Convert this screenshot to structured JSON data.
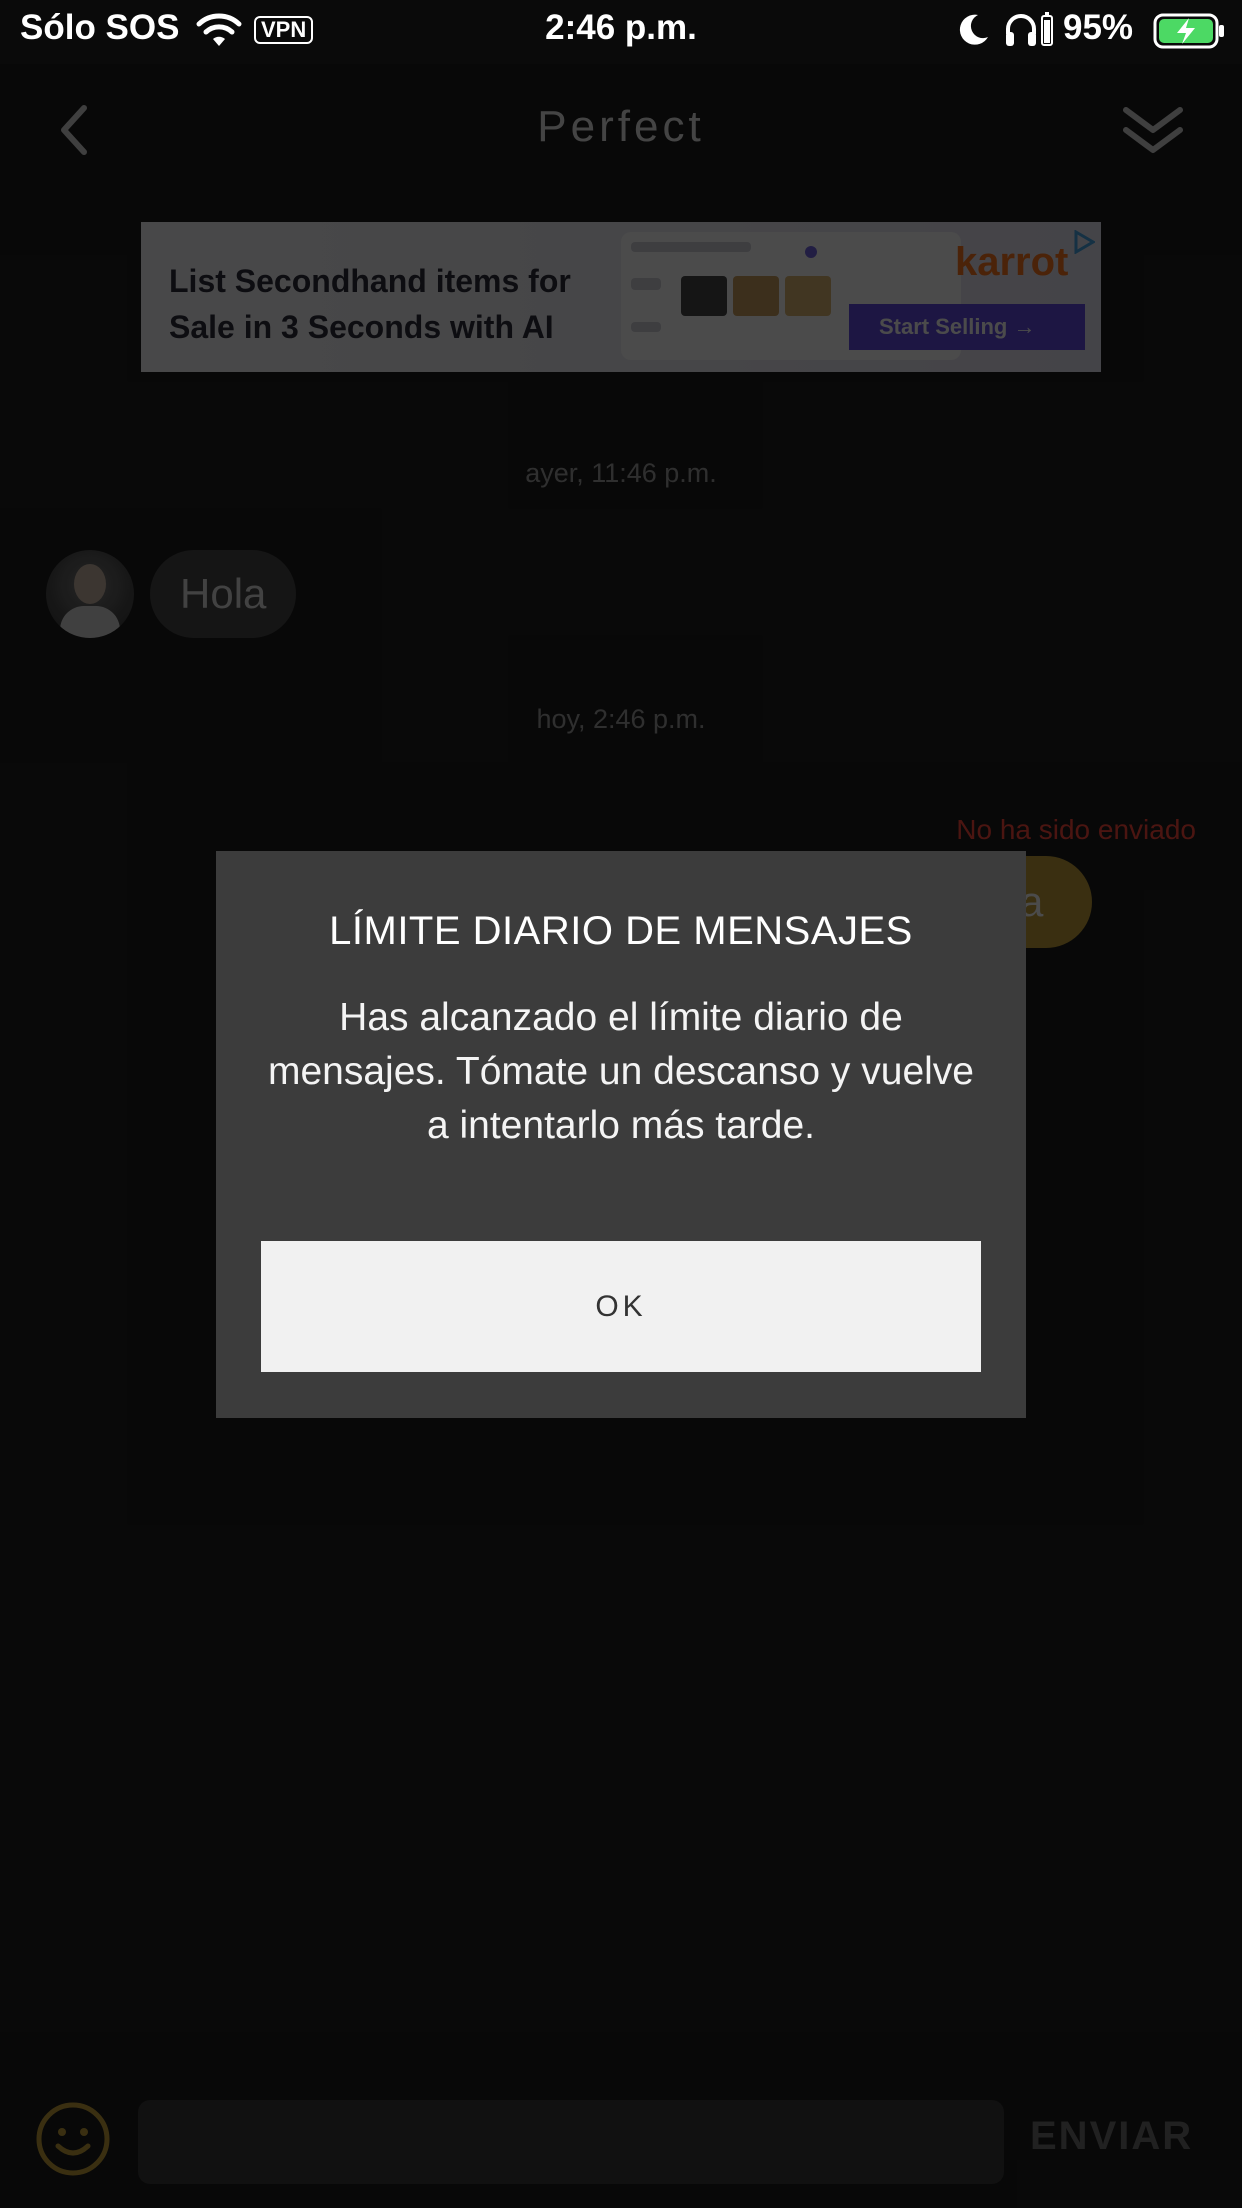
{
  "status_bar": {
    "carrier": "Sólo SOS",
    "vpn": "VPN",
    "time": "2:46 p.m.",
    "battery_percent": "95%",
    "icons": [
      "wifi-icon",
      "moon-icon",
      "headphones-icon",
      "battery-icon"
    ]
  },
  "header": {
    "title": "Perfect",
    "icons": [
      "chevron-left-icon",
      "double-chevron-down-icon"
    ]
  },
  "ad": {
    "headline": "List Secondhand items for Sale in 3 Seconds with AI",
    "brand": "karrot",
    "cta": "Start Selling →"
  },
  "chat": {
    "timestamp_1": "ayer, 11:46 p.m.",
    "incoming_message": "Hola",
    "timestamp_2": "hoy, 2:46 p.m.",
    "not_sent_label": "No ha sido enviado",
    "outgoing_message_visible": "a"
  },
  "input_bar": {
    "placeholder": "",
    "send_label": "ENVIAR",
    "icons": [
      "emoji-icon"
    ]
  },
  "dialog": {
    "title": "LÍMITE DIARIO DE MENSAJES",
    "message": "Has alcanzado el límite diario de mensajes. Tómate un descanso y vuelve a intentarlo más tarde.",
    "ok_label": "OK"
  },
  "colors": {
    "background": "#0a0a0a",
    "dialog": "#3c3c3c",
    "ok_button": "#f1f1f1",
    "not_sent": "#ff3b2f",
    "outgoing_bubble": "#c19a2a",
    "battery_fill": "#4cd964"
  }
}
